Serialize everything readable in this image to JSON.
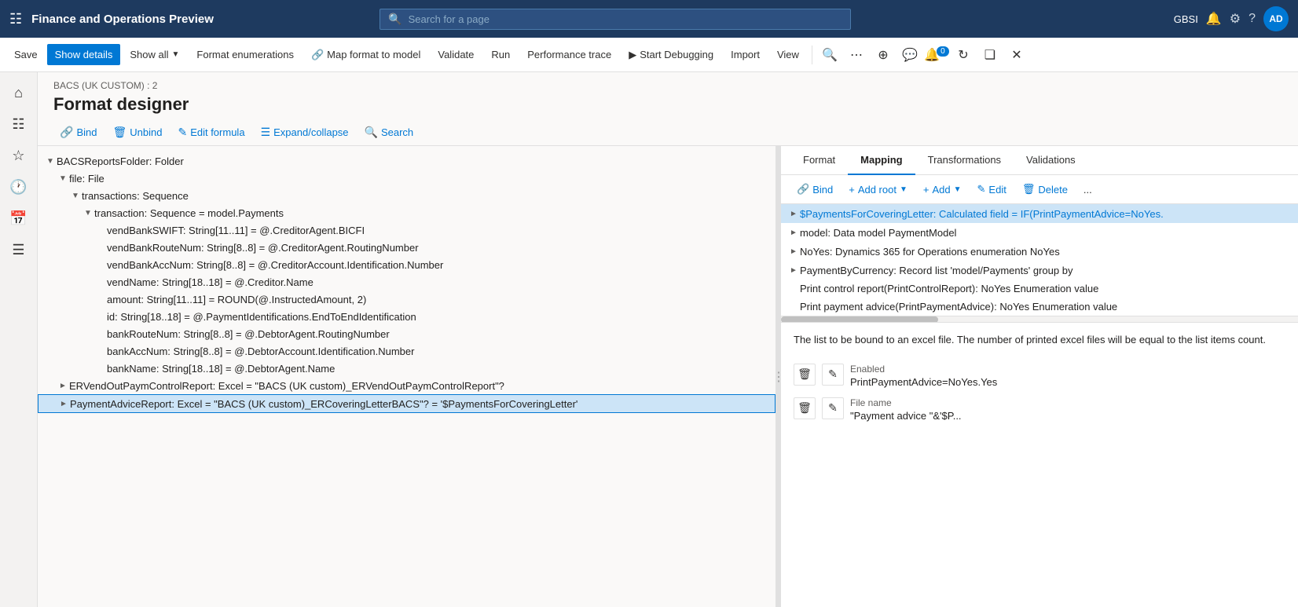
{
  "topNav": {
    "appTitle": "Finance and Operations Preview",
    "searchPlaceholder": "Search for a page",
    "userInitials": "GBSI",
    "userAvatar": "AD"
  },
  "commandBar": {
    "saveLabel": "Save",
    "showDetailsLabel": "Show details",
    "showAllLabel": "Show all",
    "formatEnumerationsLabel": "Format enumerations",
    "mapFormatToModelLabel": "Map format to model",
    "validateLabel": "Validate",
    "runLabel": "Run",
    "performanceTraceLabel": "Performance trace",
    "startDebuggingLabel": "Start Debugging",
    "importLabel": "Import",
    "viewLabel": "View"
  },
  "pageHeader": {
    "breadcrumb": "BACS (UK CUSTOM) : 2",
    "title": "Format designer"
  },
  "contentToolbar": {
    "bindLabel": "Bind",
    "unbindLabel": "Unbind",
    "editFormulaLabel": "Edit formula",
    "expandCollapseLabel": "Expand/collapse",
    "searchLabel": "Search"
  },
  "tree": {
    "items": [
      {
        "id": 1,
        "indent": 0,
        "expanded": true,
        "label": "BACSReportsFolder: Folder"
      },
      {
        "id": 2,
        "indent": 1,
        "expanded": true,
        "label": "file: File"
      },
      {
        "id": 3,
        "indent": 2,
        "expanded": true,
        "label": "transactions: Sequence"
      },
      {
        "id": 4,
        "indent": 3,
        "expanded": true,
        "label": "transaction: Sequence = model.Payments"
      },
      {
        "id": 5,
        "indent": 4,
        "expanded": false,
        "label": "vendBankSWIFT: String[11..11] = @.CreditorAgent.BICFI"
      },
      {
        "id": 6,
        "indent": 4,
        "expanded": false,
        "label": "vendBankRouteNum: String[8..8] = @.CreditorAgent.RoutingNumber"
      },
      {
        "id": 7,
        "indent": 4,
        "expanded": false,
        "label": "vendBankAccNum: String[8..8] = @.CreditorAccount.Identification.Number"
      },
      {
        "id": 8,
        "indent": 4,
        "expanded": false,
        "label": "vendName: String[18..18] = @.Creditor.Name"
      },
      {
        "id": 9,
        "indent": 4,
        "expanded": false,
        "label": "amount: String[11..11] = ROUND(@.InstructedAmount, 2)"
      },
      {
        "id": 10,
        "indent": 4,
        "expanded": false,
        "label": "id: String[18..18] = @.PaymentIdentifications.EndToEndIdentification"
      },
      {
        "id": 11,
        "indent": 4,
        "expanded": false,
        "label": "bankRouteNum: String[8..8] = @.DebtorAgent.RoutingNumber"
      },
      {
        "id": 12,
        "indent": 4,
        "expanded": false,
        "label": "bankAccNum: String[8..8] = @.DebtorAccount.Identification.Number"
      },
      {
        "id": 13,
        "indent": 4,
        "expanded": false,
        "label": "bankName: String[18..18] = @.DebtorAgent.Name"
      },
      {
        "id": 14,
        "indent": 1,
        "expanded": false,
        "label": "ERVendOutPaymControlReport: Excel = \"BACS (UK custom)_ERVendOutPaymControlReport\"?"
      },
      {
        "id": 15,
        "indent": 1,
        "expanded": false,
        "label": "PaymentAdviceReport: Excel = \"BACS (UK custom)_ERCoveringLetterBACS\"? = '$PaymentsForCoveringLetter'",
        "selected": true
      }
    ]
  },
  "mappingPanel": {
    "tabs": [
      {
        "id": "format",
        "label": "Format"
      },
      {
        "id": "mapping",
        "label": "Mapping",
        "active": true
      },
      {
        "id": "transformations",
        "label": "Transformations"
      },
      {
        "id": "validations",
        "label": "Validations"
      }
    ],
    "toolbar": {
      "bindLabel": "Bind",
      "addRootLabel": "Add root",
      "addLabel": "Add",
      "editLabel": "Edit",
      "deleteLabel": "Delete",
      "moreLabel": "..."
    },
    "treeItems": [
      {
        "id": 1,
        "indent": 0,
        "expanded": false,
        "label": "$PaymentsForCoveringLetter: Calculated field = IF(PrintPaymentAdvice=NoYes.",
        "selected": true
      },
      {
        "id": 2,
        "indent": 0,
        "expanded": false,
        "label": "model: Data model PaymentModel"
      },
      {
        "id": 3,
        "indent": 0,
        "expanded": false,
        "label": "NoYes: Dynamics 365 for Operations enumeration NoYes"
      },
      {
        "id": 4,
        "indent": 0,
        "expanded": false,
        "label": "PaymentByCurrency: Record list 'model/Payments' group by"
      },
      {
        "id": 5,
        "indent": 0,
        "expanded": false,
        "label": "Print control report(PrintControlReport): NoYes Enumeration value"
      },
      {
        "id": 6,
        "indent": 0,
        "expanded": false,
        "label": "Print payment advice(PrintPaymentAdvice): NoYes Enumeration value"
      }
    ],
    "description": "The list to be bound to an excel file. The number of printed excel files will be equal to the list items count.",
    "properties": [
      {
        "id": "enabled",
        "label": "Enabled",
        "value": "PrintPaymentAdvice=NoYes.Yes"
      },
      {
        "id": "filename",
        "label": "File name",
        "value": "\"Payment advice \"&'$P..."
      }
    ]
  }
}
